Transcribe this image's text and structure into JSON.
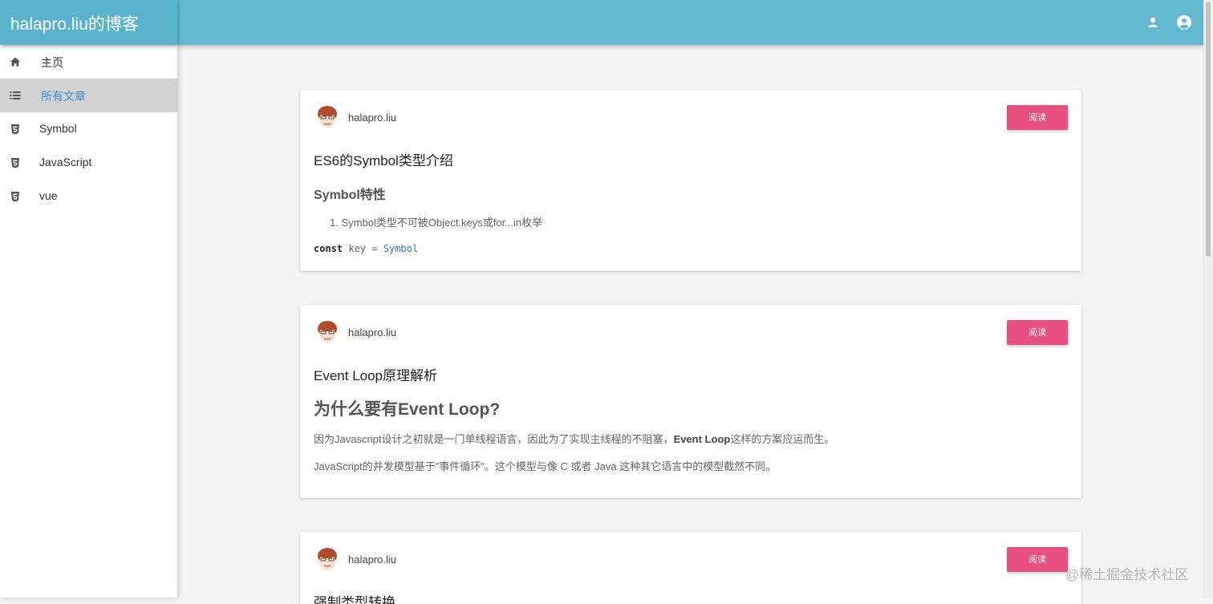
{
  "header": {
    "title": "halapro.liu的博客",
    "icons": [
      "user-icon",
      "account-circle-icon"
    ],
    "accent_color": "#62b9d1"
  },
  "sidebar": {
    "items": [
      {
        "label": "主页",
        "icon": "home-icon",
        "active": false
      },
      {
        "label": "所有文章",
        "icon": "list-icon",
        "active": true
      },
      {
        "label": "Symbol",
        "icon": "html5-icon",
        "active": false
      },
      {
        "label": "JavaScript",
        "icon": "html5-icon",
        "active": false
      },
      {
        "label": "vue",
        "icon": "html5-icon",
        "active": false
      }
    ]
  },
  "posts": [
    {
      "author": "halapro.liu",
      "read_label": "阅读",
      "title": "ES6的Symbol类型介绍",
      "subheading": "Symbol特性",
      "list_item": "1. Symbol类型不可被Object.keys或for...in枚举",
      "code": {
        "keyword": "const",
        "ident": " key = ",
        "func": "Symbol"
      }
    },
    {
      "author": "halapro.liu",
      "read_label": "阅读",
      "title": "Event Loop原理解析",
      "heading": "为什么要有Event Loop?",
      "para1_pre": "因为Javascript设计之初就是一门单线程语言，因此为了实现主线程的不阻塞，",
      "para1_bold": "Event Loop",
      "para1_post": "这样的方案应运而生。",
      "para2": "JavaScript的并发模型基于\"事件循环\"。这个模型与像 C 或者 Java 这种其它语言中的模型截然不同。"
    },
    {
      "author": "halapro.liu",
      "read_label": "阅读",
      "title": "强制类型转换"
    }
  ],
  "watermark": "@稀土掘金技术社区",
  "button_color": "#e8517f"
}
